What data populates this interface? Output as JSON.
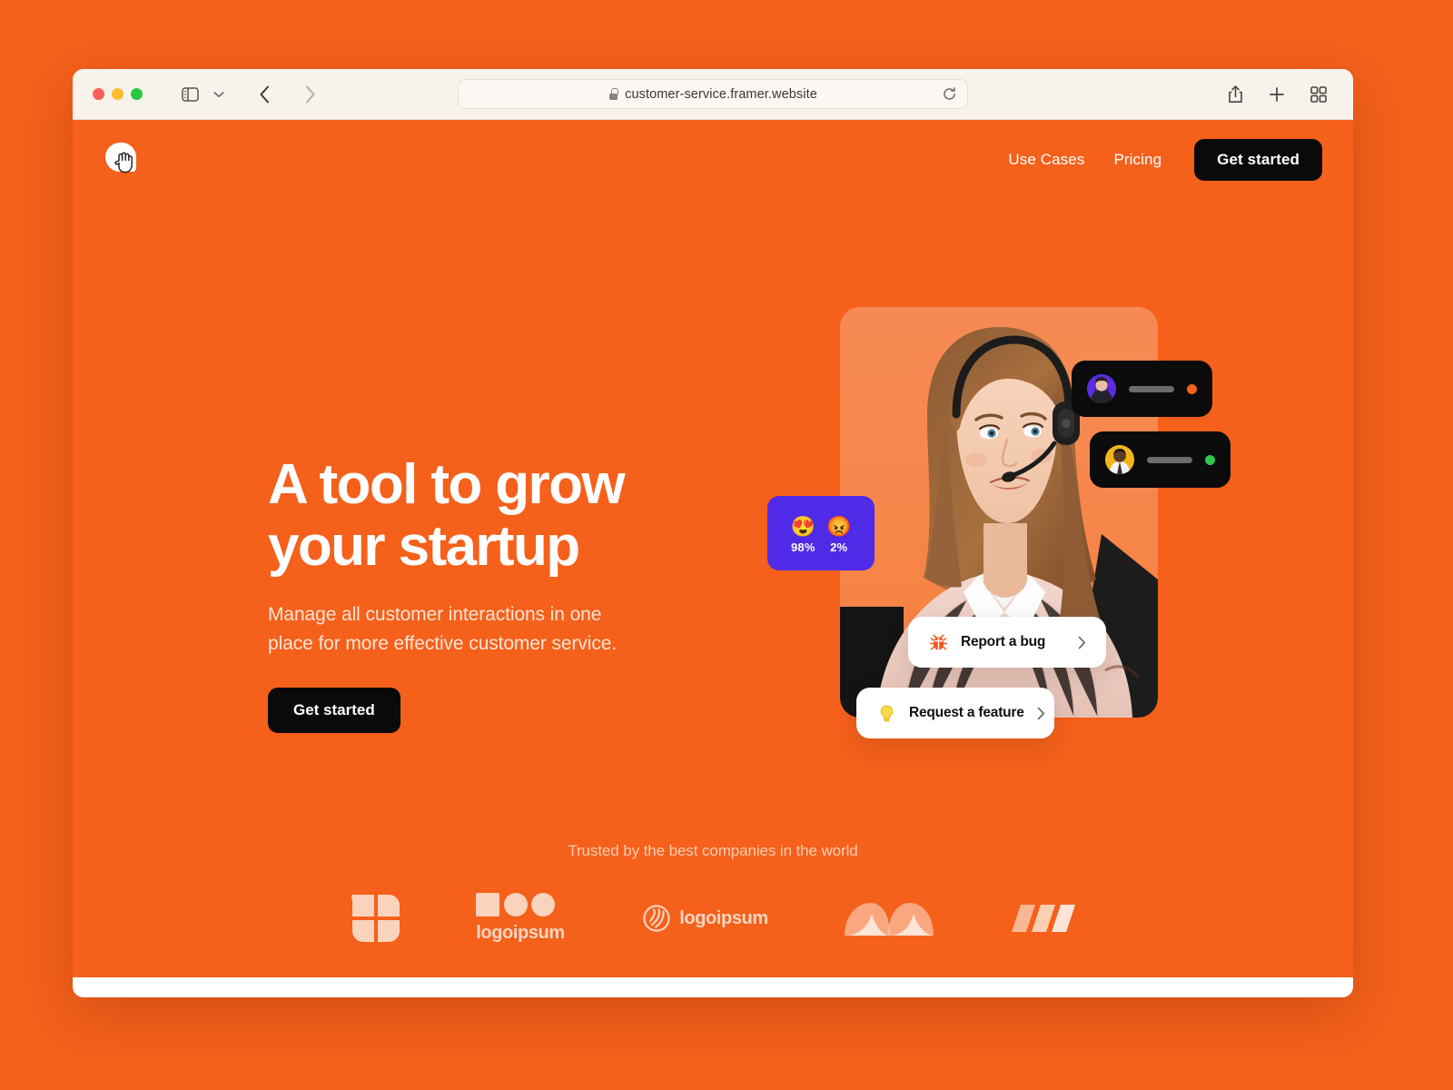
{
  "browser": {
    "url": "customer-service.framer.website",
    "secure_icon": "lock-icon",
    "traffic_lights": [
      "close",
      "minimize",
      "maximize"
    ],
    "controls": {
      "sidebar": "sidebar-toggle",
      "sidebar_chevron": "chevron-down-icon",
      "back": "back-arrow-icon",
      "forward": "forward-arrow-icon",
      "shield": "privacy-shield-icon",
      "reload": "reload-icon",
      "share": "share-icon",
      "new_tab": "plus-icon",
      "tab_overview": "tab-grid-icon"
    }
  },
  "site": {
    "logo_name": "chat-bubble-cursor-logo",
    "nav": {
      "links": [
        {
          "label": "Use Cases"
        },
        {
          "label": "Pricing"
        }
      ],
      "cta_label": "Get started"
    },
    "hero": {
      "title": "A tool to grow\nyour startup",
      "subtitle": "Manage all customer interactions in one place for more effective customer service.",
      "cta_label": "Get started"
    },
    "visual": {
      "photo_alt": "customer-support-agent-with-headset",
      "stats": [
        {
          "emoji": "😍",
          "emoji_name": "heart-eyes-emoji",
          "value": "98%"
        },
        {
          "emoji": "😡",
          "emoji_name": "angry-face-emoji",
          "value": "2%"
        }
      ],
      "chats": [
        {
          "avatar_name": "avatar-purple",
          "status": "orange"
        },
        {
          "avatar_name": "avatar-yellow",
          "status": "green"
        }
      ],
      "actions": [
        {
          "label": "Report a bug",
          "icon": "bug-icon"
        },
        {
          "label": "Request a feature",
          "icon": "lightbulb-icon"
        }
      ]
    },
    "trusted": {
      "label": "Trusted by the best companies in the world",
      "logos": [
        {
          "name": "clover-mark-logo",
          "word": ""
        },
        {
          "name": "shapes-logoipsum-logo",
          "word": "logoipsum"
        },
        {
          "name": "swirl-logoipsum-logo",
          "word": "logoipsum"
        },
        {
          "name": "waves-mark-logo",
          "word": ""
        },
        {
          "name": "slashes-mark-logo",
          "word": ""
        }
      ]
    }
  },
  "colors": {
    "brand_orange": "#F5601B",
    "card_orange": "#F5834C",
    "dark": "#0A0A0A",
    "purple": "#4F2BE8",
    "status_green": "#2EC44F",
    "subtitle": "#FCE4D6"
  }
}
